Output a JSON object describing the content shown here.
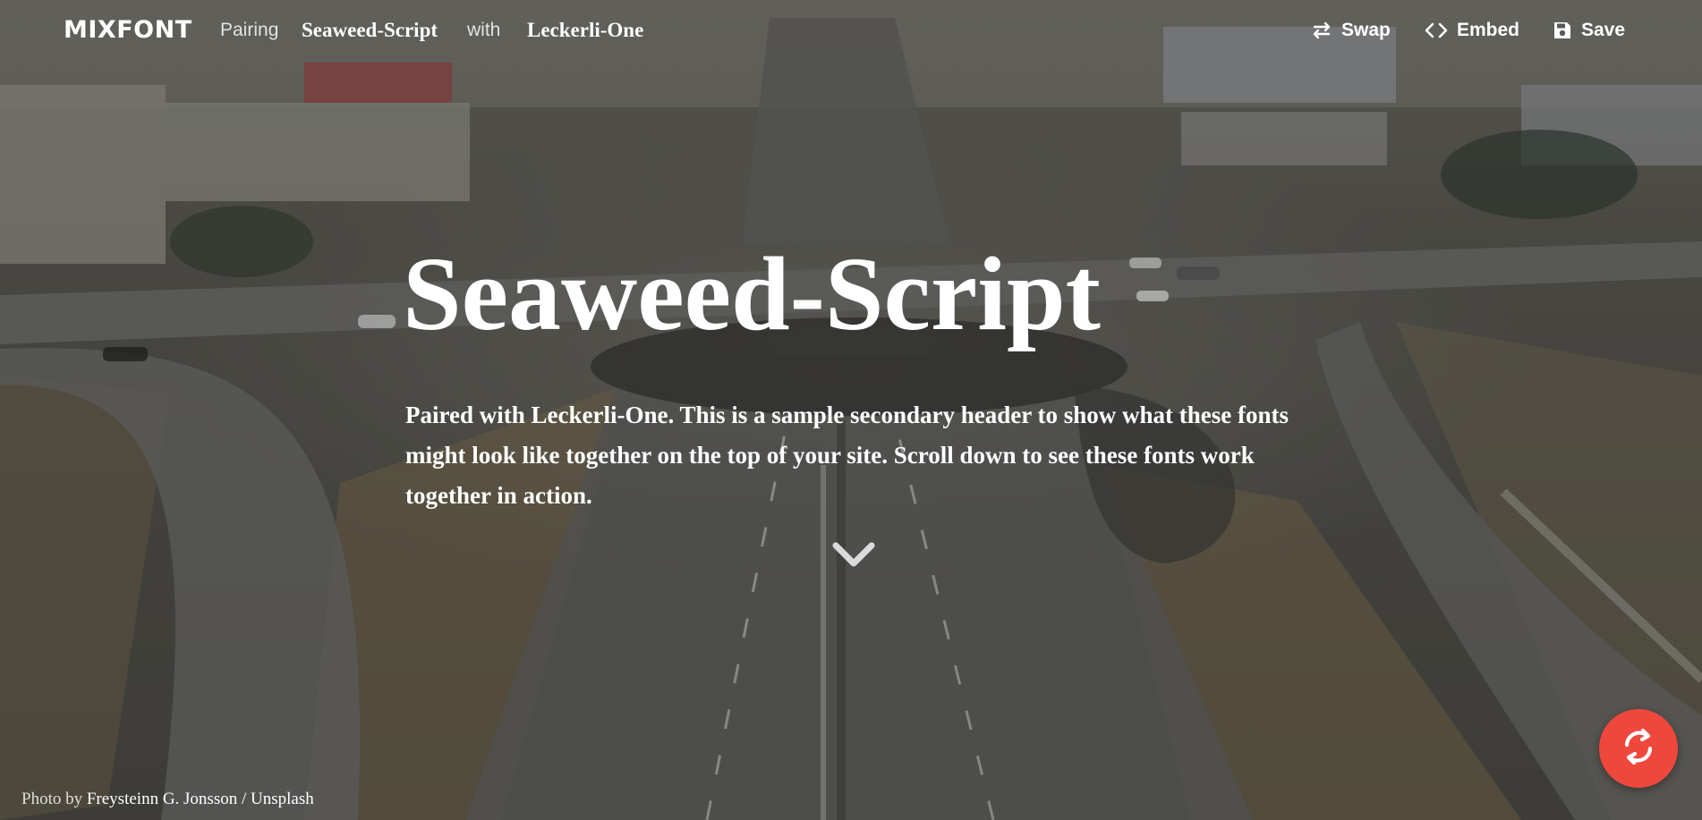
{
  "nav": {
    "logo": "MIXFONT",
    "pairing_label": "Pairing",
    "primary_font": "Seaweed-Script",
    "with_label": "with",
    "secondary_font": "Leckerli-One",
    "actions": {
      "swap": "Swap",
      "embed": "Embed",
      "save": "Save"
    }
  },
  "hero": {
    "title": "Seaweed-Script",
    "description": "Paired with Leckerli-One. This is a sample secondary header to show what these fonts might look like together on the top of your site. Scroll down to see these fonts work together in action."
  },
  "credit": {
    "prefix": "Photo by",
    "author": "Freysteinn G. Jonsson",
    "separator": "/",
    "source": "Unsplash"
  },
  "icons": {
    "swap": "swap-arrows-icon",
    "embed": "code-brackets-icon",
    "save": "floppy-disk-icon",
    "scroll": "chevron-down-icon",
    "shuffle": "refresh-icon"
  },
  "colors": {
    "fab": "#f0473d",
    "text": "#ffffff"
  }
}
